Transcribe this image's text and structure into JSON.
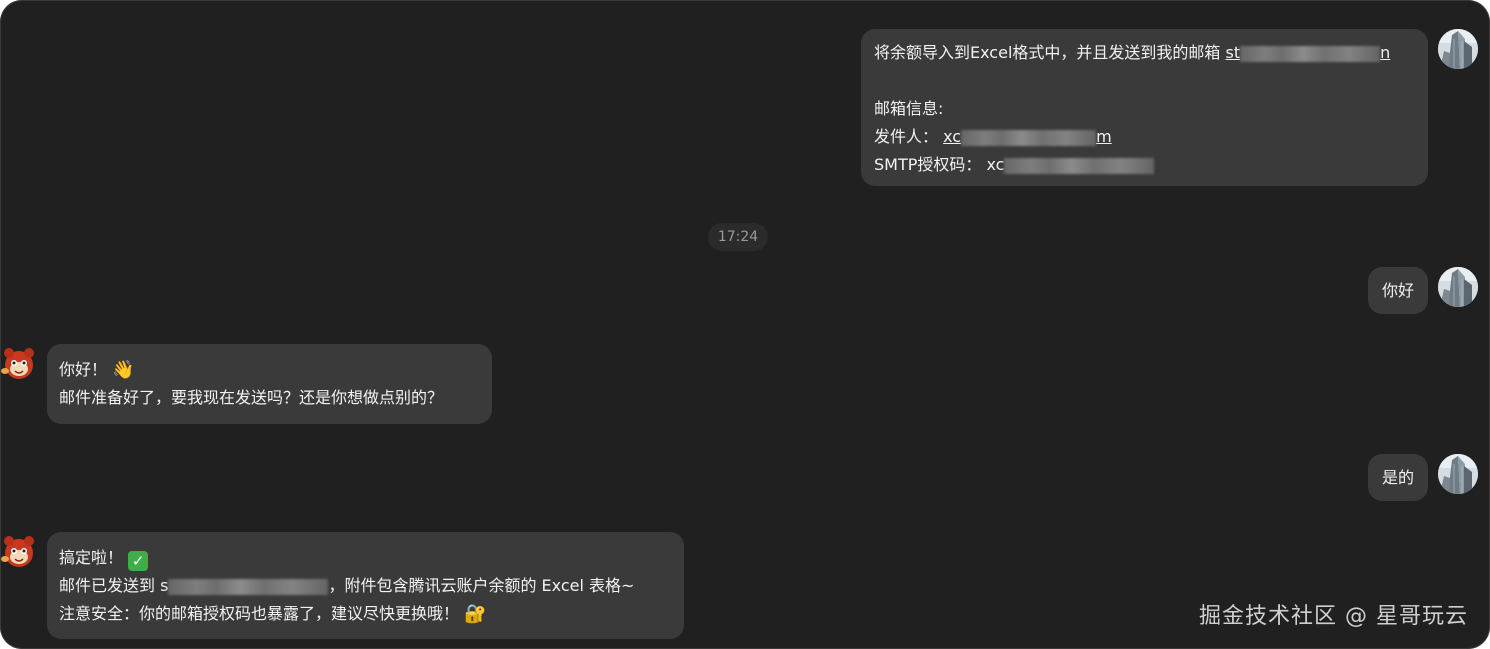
{
  "messages": {
    "user1": {
      "line1_prefix": "将余额导入到Excel格式中，并且发送到我的邮箱 ",
      "line1_email_start": "st",
      "line1_email_end": "n",
      "line3": "邮箱信息:",
      "line4_label": "发件人：",
      "line4_value_start": "xc",
      "line4_value_end": "m",
      "line5_label": "SMTP授权码：",
      "line5_value_start": "xc"
    },
    "timestamp": "17:24",
    "user2": {
      "text": "你好"
    },
    "bot1": {
      "line1": "你好！",
      "line1_emoji": "👋",
      "line2": "邮件准备好了，要我现在发送吗？还是你想做点别的？"
    },
    "user3": {
      "text": "是的"
    },
    "bot2": {
      "line1": "搞定啦！",
      "line1_emoji": "✓",
      "line2_prefix": "邮件已发送到 ",
      "line2_redacted_start": "s",
      "line2_suffix": "，附件包含腾讯云账户余额的 Excel 表格~",
      "line3": "注意安全：你的邮箱授权码也暴露了，建议尽快更换哦！",
      "line3_emoji": "🔐"
    }
  },
  "watermark": "掘金技术社区 @ 星哥玩云",
  "icons": {
    "user_avatar": "building-photo-avatar-icon",
    "bot_avatar": "red-mascot-avatar-icon"
  },
  "colors": {
    "background": "#202020",
    "bubble": "#3a3a3a",
    "text": "#f2f2f2",
    "timestamp_text": "#9a9a9a",
    "check_green": "#3fae49"
  }
}
